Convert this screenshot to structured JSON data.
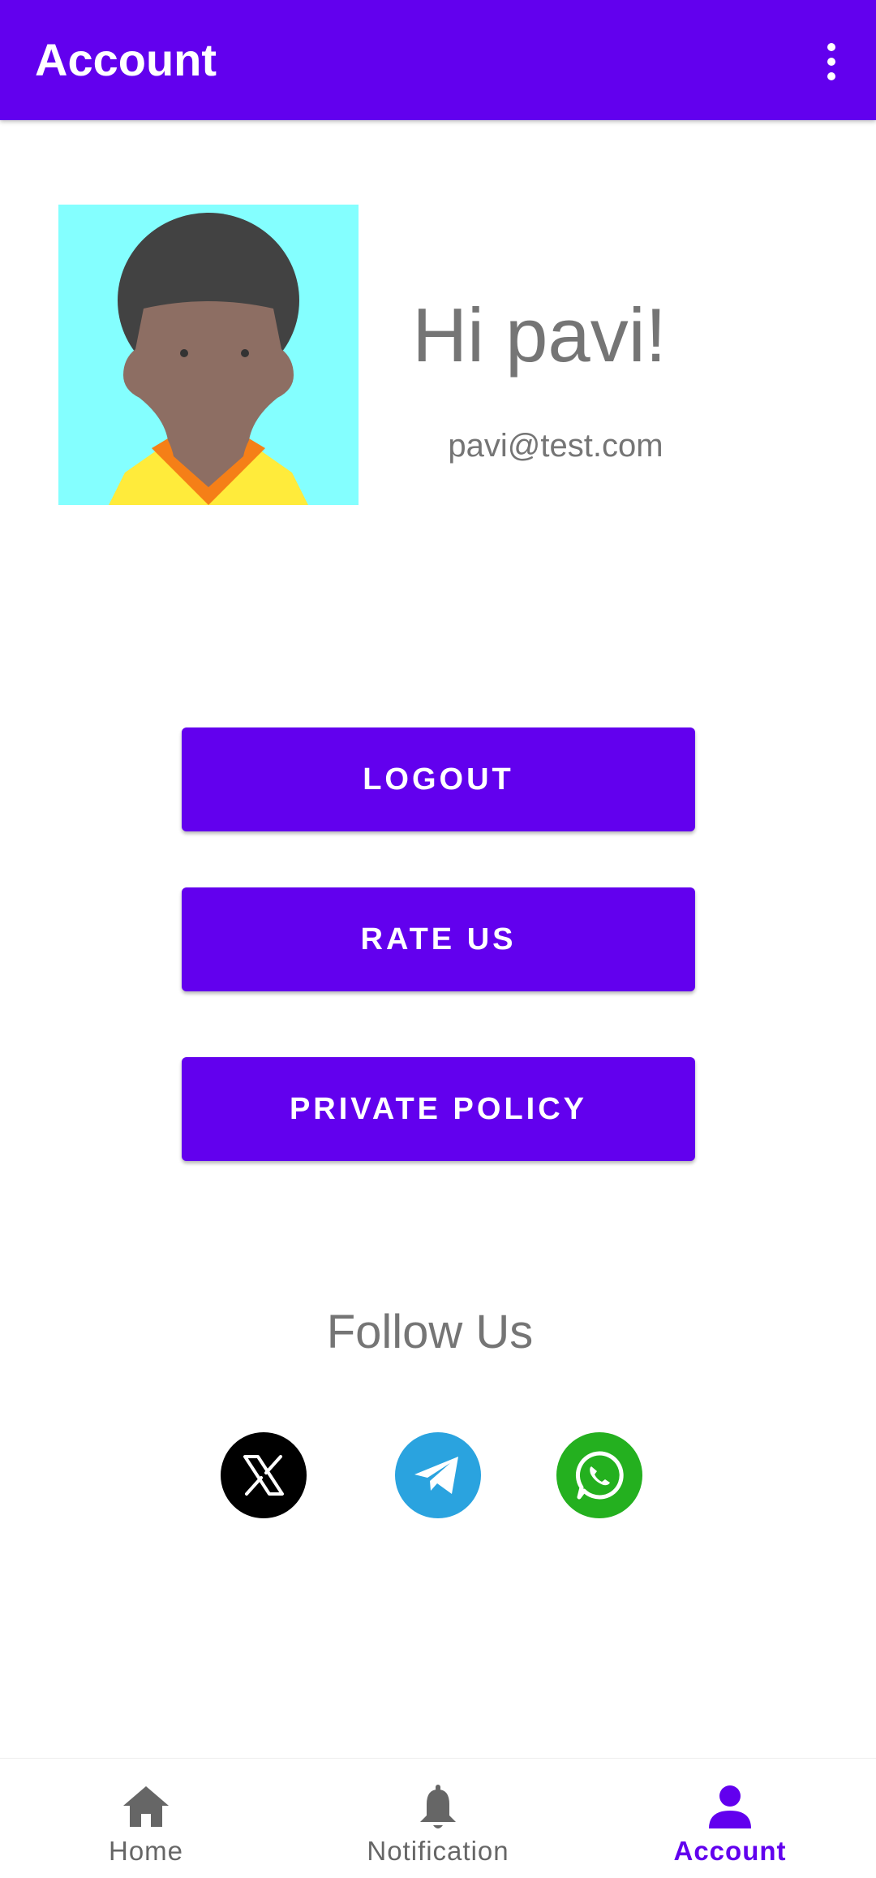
{
  "appbar": {
    "title": "Account",
    "menu_icon": "more-vert-icon"
  },
  "profile": {
    "avatar_icon": "user-avatar-illustration",
    "greeting": "Hi pavi!",
    "email": "pavi@test.com"
  },
  "buttons": {
    "logout": "LOGOUT",
    "rate_us": "RATE US",
    "private_policy": "PRIVATE POLICY"
  },
  "follow": {
    "title": "Follow Us",
    "links": [
      {
        "icon": "x-twitter-icon",
        "color": "#000000"
      },
      {
        "icon": "telegram-icon",
        "color": "#2AA3DF"
      },
      {
        "icon": "whatsapp-icon",
        "color": "#24B01F"
      }
    ]
  },
  "bottom_nav": {
    "items": [
      {
        "label": "Home",
        "icon": "home-icon",
        "active": false
      },
      {
        "label": "Notification",
        "icon": "bell-icon",
        "active": false
      },
      {
        "label": "Account",
        "icon": "person-icon",
        "active": true
      }
    ]
  },
  "colors": {
    "primary": "#6200EE",
    "text_secondary": "#757575",
    "avatar_bg": "#84FFFF"
  }
}
